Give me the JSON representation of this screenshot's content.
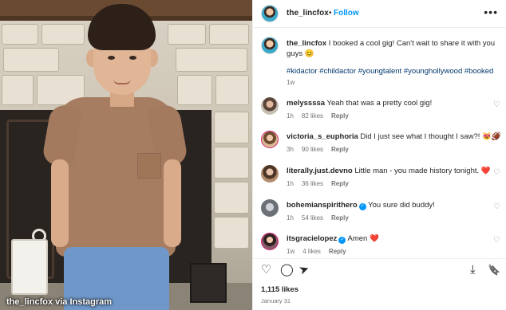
{
  "photo": {
    "credit": "the_lincfox via Instagram"
  },
  "header": {
    "username": "the_lincfox",
    "separator": "•",
    "follow_label": "Follow",
    "more_label": "•••"
  },
  "caption": {
    "username": "the_lincfox",
    "text": "I booked a cool gig! Can't wait to share it with you guys 😊",
    "hashtags": "#kidactor #childactor #youngtalent #younghollywood #booked",
    "time": "1w"
  },
  "comments": [
    {
      "username": "melyssssa",
      "text": "Yeah that was a pretty cool gig!",
      "time": "1h",
      "likes": "82 likes",
      "reply": "Reply",
      "verified": false
    },
    {
      "username": "victoria_s_euphoria",
      "text": "Did I just see what I thought I saw?! 😻🏈",
      "time": "3h",
      "likes": "90 likes",
      "reply": "Reply",
      "verified": false
    },
    {
      "username": "literally.just.devno",
      "text": "Little man - you made history tonight. ❤️",
      "time": "1h",
      "likes": "36 likes",
      "reply": "Reply",
      "verified": false
    },
    {
      "username": "bohemianspirithero",
      "text": "You sure did buddy!",
      "time": "1h",
      "likes": "54 likes",
      "reply": "Reply",
      "verified": true
    },
    {
      "username": "itsgracielopez",
      "text": "Amen ❤️",
      "time": "1w",
      "likes": "4 likes",
      "reply": "Reply",
      "verified": true
    }
  ],
  "actions": {
    "like_icon": "♡",
    "comment_icon": "◯",
    "share_icon": "➤",
    "download_icon": "⤓",
    "save_icon": "🔖"
  },
  "footer": {
    "likes": "1,115 likes",
    "date": "January 31"
  },
  "colors": {
    "accent": "#0095f6",
    "heart": "#ed4956",
    "hashtag": "#00376b",
    "muted": "#737373"
  }
}
